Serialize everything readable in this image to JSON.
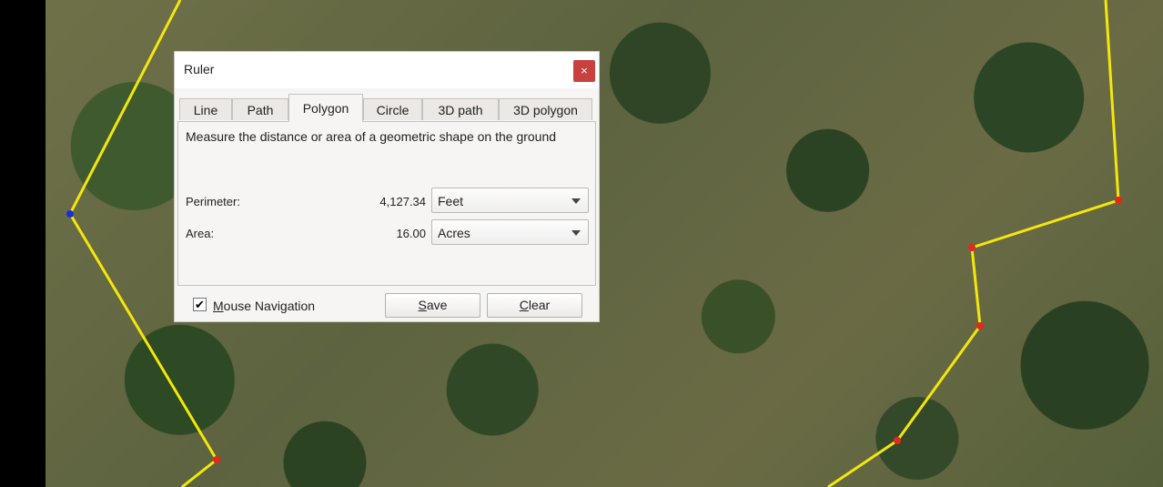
{
  "map": {
    "path_color": "#f5e70a",
    "vertex_color": "#e8261c",
    "selected_vertex_color": "#1530d8"
  },
  "dialog": {
    "title": "Ruler",
    "close_glyph": "×",
    "close_color": "#c8413f",
    "tabs": [
      {
        "label": "Line",
        "active": false
      },
      {
        "label": "Path",
        "active": false
      },
      {
        "label": "Polygon",
        "active": true
      },
      {
        "label": "Circle",
        "active": false
      },
      {
        "label": "3D path",
        "active": false
      },
      {
        "label": "3D polygon",
        "active": false
      }
    ],
    "description": "Measure the distance or area of a geometric shape on the ground",
    "perimeter": {
      "label": "Perimeter:",
      "value": "4,127.34",
      "unit": "Feet"
    },
    "area": {
      "label": "Area:",
      "value": "16.00",
      "unit": "Acres"
    },
    "mouse_navigation": {
      "label": "Mouse Navigation",
      "checked": true,
      "check_glyph": "✔"
    },
    "save_label": "Save",
    "clear_label": "Clear"
  }
}
